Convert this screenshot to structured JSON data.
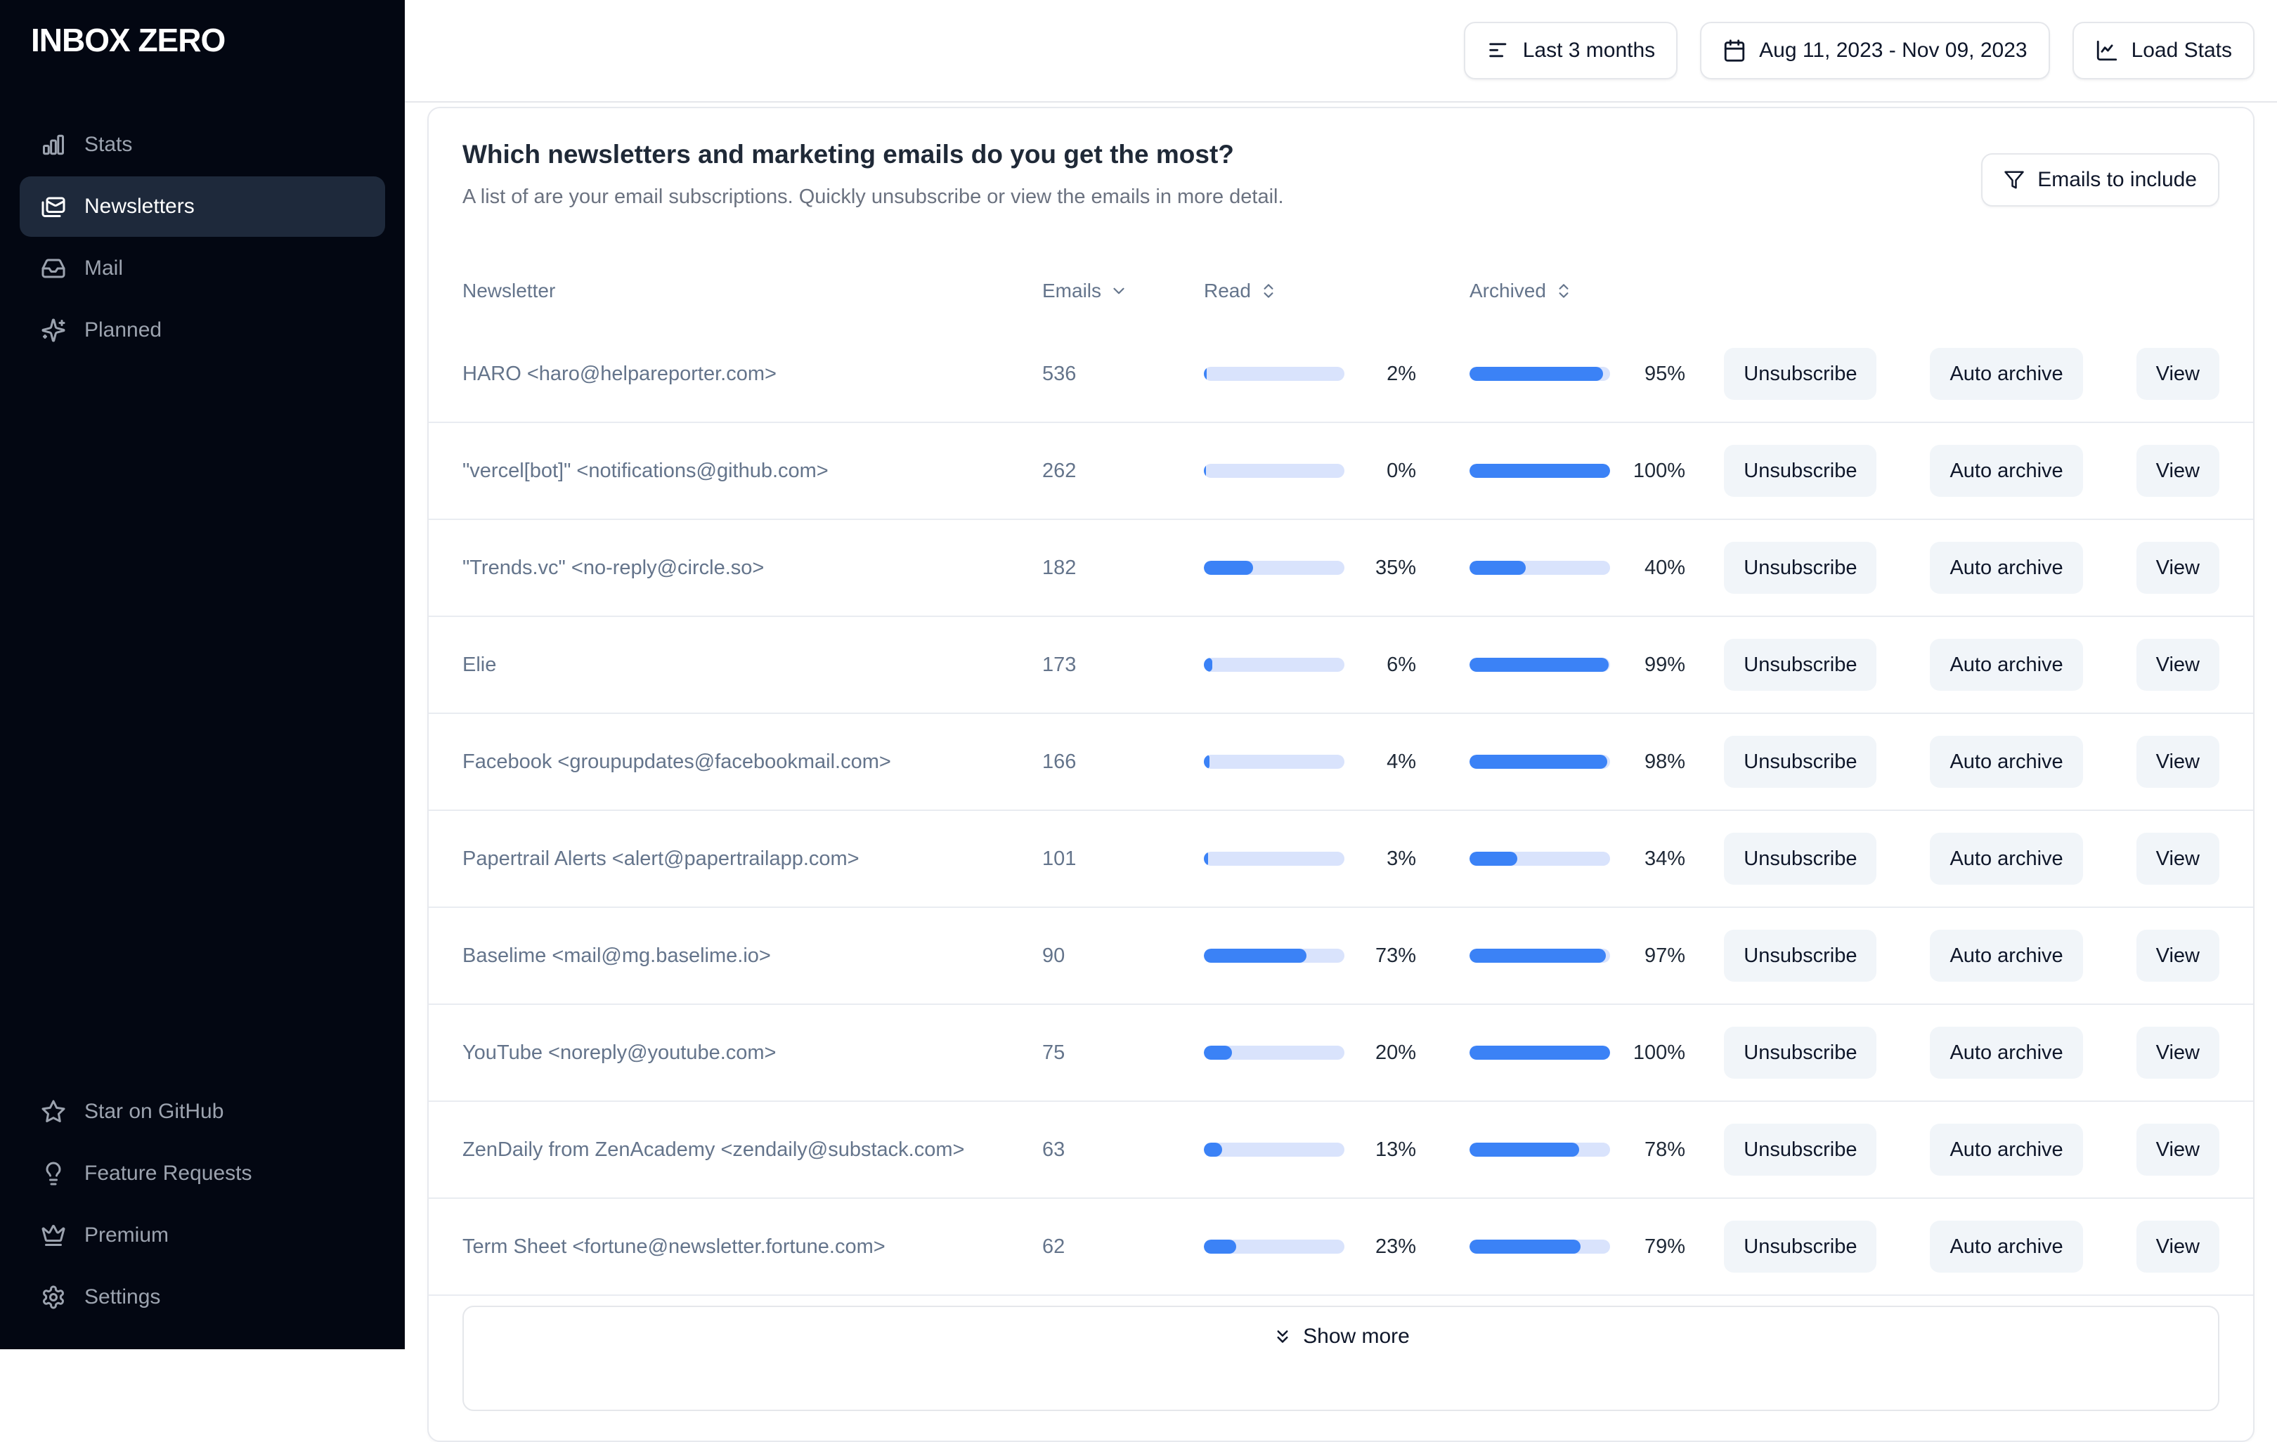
{
  "sidebar": {
    "brand": "INBOX ZERO",
    "nav": [
      {
        "id": "stats",
        "label": "Stats",
        "icon": "bar-chart-icon",
        "active": false
      },
      {
        "id": "newsletters",
        "label": "Newsletters",
        "icon": "mails-icon",
        "active": true
      },
      {
        "id": "mail",
        "label": "Mail",
        "icon": "inbox-icon",
        "active": false
      },
      {
        "id": "planned",
        "label": "Planned",
        "icon": "sparkles-icon",
        "active": false
      }
    ],
    "footer_nav": [
      {
        "id": "star-on-github",
        "label": "Star on GitHub",
        "icon": "star-icon",
        "active": false
      },
      {
        "id": "feature-requests",
        "label": "Feature Requests",
        "icon": "lightbulb-icon",
        "active": false
      },
      {
        "id": "premium",
        "label": "Premium",
        "icon": "crown-icon",
        "active": false
      },
      {
        "id": "settings",
        "label": "Settings",
        "icon": "gear-icon",
        "active": false
      }
    ]
  },
  "topbar": {
    "range_button": "Last 3 months",
    "date_button": "Aug 11, 2023 - Nov 09, 2023",
    "load_button": "Load Stats"
  },
  "newsletters_card": {
    "title": "Which newsletters and marketing emails do you get the most?",
    "subtitle": "A list of are your email subscriptions. Quickly unsubscribe or view the emails in more detail.",
    "filter_button": "Emails to include",
    "columns": {
      "newsletter": "Newsletter",
      "emails": "Emails",
      "read": "Read",
      "archived": "Archived"
    },
    "actions": {
      "unsubscribe": "Unsubscribe",
      "auto_archive": "Auto archive",
      "view": "View"
    },
    "show_more": "Show more",
    "rows": [
      {
        "name": "HARO <haro@helpareporter.com>",
        "emails": 536,
        "read_pct": 2,
        "archived_pct": 95
      },
      {
        "name": "\"vercel[bot]\" <notifications@github.com>",
        "emails": 262,
        "read_pct": 0,
        "archived_pct": 100
      },
      {
        "name": "\"Trends.vc\" <no-reply@circle.so>",
        "emails": 182,
        "read_pct": 35,
        "archived_pct": 40
      },
      {
        "name": "Elie",
        "emails": 173,
        "read_pct": 6,
        "archived_pct": 99
      },
      {
        "name": "Facebook <groupupdates@facebookmail.com>",
        "emails": 166,
        "read_pct": 4,
        "archived_pct": 98
      },
      {
        "name": "Papertrail Alerts <alert@papertrailapp.com>",
        "emails": 101,
        "read_pct": 3,
        "archived_pct": 34
      },
      {
        "name": "Baselime <mail@mg.baselime.io>",
        "emails": 90,
        "read_pct": 73,
        "archived_pct": 97
      },
      {
        "name": "YouTube <noreply@youtube.com>",
        "emails": 75,
        "read_pct": 20,
        "archived_pct": 100
      },
      {
        "name": "ZenDaily from ZenAcademy <zendaily@substack.com>",
        "emails": 63,
        "read_pct": 13,
        "archived_pct": 78
      },
      {
        "name": "Term Sheet <fortune@newsletter.fortune.com>",
        "emails": 62,
        "read_pct": 23,
        "archived_pct": 79
      }
    ]
  },
  "colors": {
    "accent_blue": "#3b82f6",
    "bar_track": "#d9e3fc",
    "sidebar_bg": "#030712",
    "sidebar_active_bg": "#1e293b",
    "border": "#e5e7eb"
  }
}
